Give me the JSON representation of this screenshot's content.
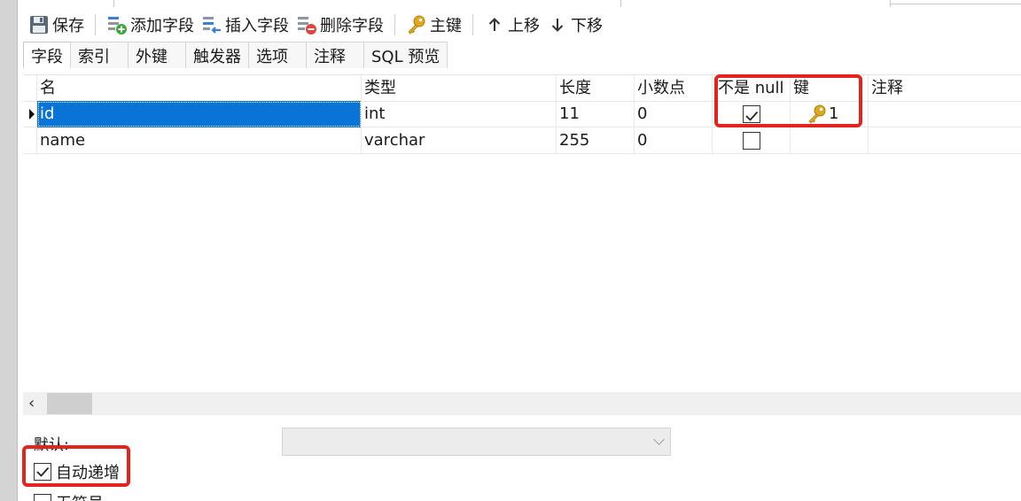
{
  "toolbar": {
    "save": "保存",
    "add_field": "添加字段",
    "insert_field": "插入字段",
    "delete_field": "删除字段",
    "primary_key": "主键",
    "move_up": "上移",
    "move_down": "下移"
  },
  "tabs": [
    "字段",
    "索引",
    "外键",
    "触发器",
    "选项",
    "注释",
    "SQL 预览"
  ],
  "columns": {
    "name": "名",
    "type": "类型",
    "length": "长度",
    "decimals": "小数点",
    "not_null": "不是 null",
    "key": "键",
    "comment": "注释"
  },
  "rows": [
    {
      "name": "id",
      "type": "int",
      "length": "11",
      "decimals": "0",
      "not_null": true,
      "key": "1",
      "comment": ""
    },
    {
      "name": "name",
      "type": "varchar",
      "length": "255",
      "decimals": "0",
      "not_null": false,
      "key": "",
      "comment": ""
    }
  ],
  "props": {
    "default_label": "默认:",
    "default_value": "",
    "auto_increment_label": "自动递增",
    "auto_increment": true,
    "unsigned_label": "无符号",
    "unsigned": false
  },
  "colors": {
    "selection": "#0a74d6",
    "highlight_box": "#e5231e",
    "key_icon": "#e0a81c"
  },
  "icons": {
    "save": "floppy-disk-icon",
    "add_field": "add-field-icon",
    "insert_field": "insert-field-icon",
    "delete_field": "delete-field-icon",
    "primary_key": "key-icon",
    "move_up": "arrow-up-icon",
    "move_down": "arrow-down-icon"
  }
}
